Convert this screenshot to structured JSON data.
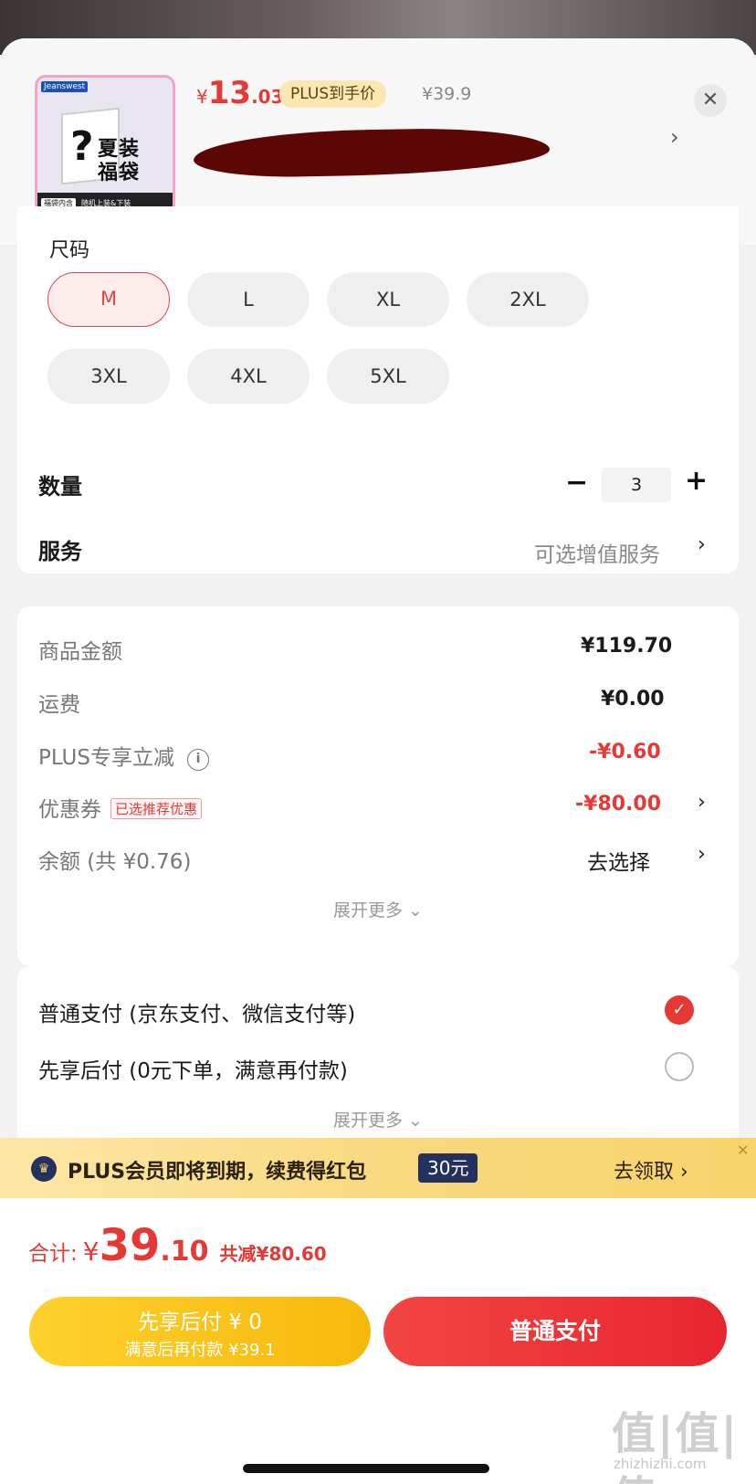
{
  "product": {
    "thumb_brand": "Jeanswest",
    "thumb_title_1": "夏装",
    "thumb_title_2": "福袋",
    "thumb_tag": "福袋内含",
    "thumb_sub": "随机上装&下装",
    "price_symbol": "¥",
    "price_int": "13",
    "price_dec": ".03",
    "plus_tag": "PLUS到手价",
    "original_price": "¥39.9"
  },
  "size": {
    "title": "尺码",
    "options": [
      "M",
      "L",
      "XL",
      "2XL",
      "3XL",
      "4XL",
      "5XL"
    ],
    "selected": "M"
  },
  "quantity": {
    "label": "数量",
    "value": "3"
  },
  "service": {
    "label": "服务",
    "value": "可选增值服务"
  },
  "summary": {
    "goods_label": "商品金额",
    "goods_value": "¥119.70",
    "shipping_label": "运费",
    "shipping_value": "¥0.00",
    "plus_label": "PLUS专享立减",
    "plus_value": "-¥0.60",
    "coupon_label": "优惠券",
    "coupon_tag": "已选推荐优惠",
    "coupon_value": "-¥80.00",
    "balance_label": "余额 (共 ¥0.76)",
    "balance_value": "去选择",
    "expand": "展开更多 ⌄"
  },
  "payment": {
    "normal_label": "普通支付 (京东支付、微信支付等)",
    "later_label": "先享后付 (0元下单，满意再付款)",
    "selected": "normal",
    "expand": "展开更多 ⌄"
  },
  "banner": {
    "text": "PLUS会员即将到期，续费得红包",
    "amount": "30元",
    "action": "去领取 ›"
  },
  "total": {
    "label": "合计:",
    "yen": "¥",
    "int": "39",
    "dec": ".10",
    "discount": "共减¥80.60"
  },
  "buttons": {
    "later_line1": "先享后付 ¥ 0",
    "later_line2": "满意后再付款 ¥39.1",
    "normal": "普通支付"
  },
  "watermark": {
    "text": "值|值|值",
    "url": "zhizhizhi.com"
  },
  "colors": {
    "accent_red": "#e53935",
    "plus_gold": "#f8d77a",
    "later_yellow": "#f7b80c"
  }
}
